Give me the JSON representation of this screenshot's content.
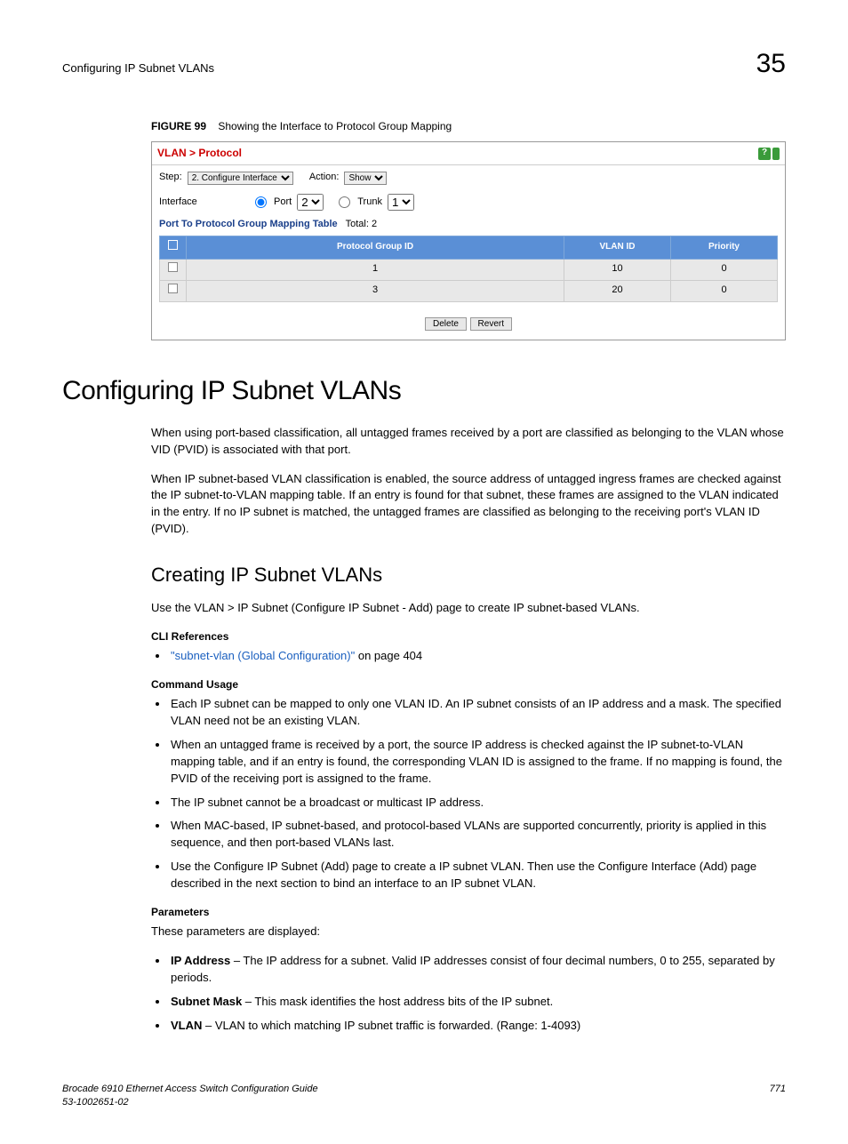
{
  "header": {
    "left": "Configuring IP Subnet VLANs",
    "right": "35"
  },
  "figure": {
    "label": "FIGURE 99",
    "caption": "Showing the Interface to Protocol Group Mapping",
    "panelTitle": "VLAN > Protocol",
    "stepLabel": "Step:",
    "stepValue": "2. Configure Interface",
    "actionLabel": "Action:",
    "actionValue": "Show",
    "interfaceLabel": "Interface",
    "portLabel": "Port",
    "portValue": "2",
    "trunkLabel": "Trunk",
    "trunkValue": "1",
    "tableCaption": "Port To Protocol Group Mapping Table",
    "tableTotal": "Total: 2",
    "headers": {
      "col1": "Protocol Group ID",
      "col2": "VLAN ID",
      "col3": "Priority"
    },
    "rows": [
      {
        "group": "1",
        "vlan": "10",
        "priority": "0"
      },
      {
        "group": "3",
        "vlan": "20",
        "priority": "0"
      }
    ],
    "deleteBtn": "Delete",
    "revertBtn": "Revert"
  },
  "h1": "Configuring IP Subnet VLANs",
  "intro1": "When using port-based classification, all untagged frames received by a port are classified as belonging to the VLAN whose VID (PVID) is associated with that port.",
  "intro2": "When IP subnet-based VLAN classification is enabled, the source address of untagged ingress frames are checked against the IP subnet-to-VLAN mapping table. If an entry is found for that subnet, these frames are assigned to the VLAN indicated in the entry. If no IP subnet is matched, the untagged frames are classified as belonging to the receiving port's VLAN ID (PVID).",
  "h2": "Creating IP Subnet VLANs",
  "intro3": "Use the VLAN > IP Subnet (Configure IP Subnet - Add) page to create IP subnet-based VLANs.",
  "cliRefLabel": "CLI References",
  "cliRefLink": "\"subnet-vlan (Global Configuration)\"",
  "cliRefSuffix": " on page 404",
  "commandUsageLabel": "Command Usage",
  "usage": [
    "Each IP subnet can be mapped to only one VLAN ID. An IP subnet consists of an IP address and a mask. The specified VLAN need not be an existing VLAN.",
    "When an untagged frame is received by a port, the source IP address is checked against the IP subnet-to-VLAN mapping table, and if an entry is found, the corresponding VLAN ID is assigned to the frame. If no mapping is found, the PVID of the receiving port is assigned to the frame.",
    "The IP subnet cannot be a broadcast or multicast IP address.",
    "When MAC-based, IP subnet-based, and protocol-based VLANs are supported concurrently, priority is applied in this sequence, and then port-based VLANs last.",
    "Use the Configure IP Subnet (Add) page to create a IP subnet VLAN. Then use the Configure Interface (Add) page described in the next section to bind an interface to an IP subnet VLAN."
  ],
  "paramsLabel": "Parameters",
  "paramsIntro": "These parameters are displayed:",
  "params": [
    {
      "term": "IP Address",
      "desc": " – The IP address for a subnet. Valid IP addresses consist of four decimal numbers, 0 to 255, separated by periods."
    },
    {
      "term": "Subnet Mask",
      "desc": " – This mask identifies the host address bits of the IP subnet."
    },
    {
      "term": "VLAN",
      "desc": " – VLAN to which matching IP subnet traffic is forwarded. (Range: 1-4093)"
    }
  ],
  "footer": {
    "line1": "Brocade 6910 Ethernet Access Switch Configuration Guide",
    "line2": "53-1002651-02",
    "page": "771"
  }
}
